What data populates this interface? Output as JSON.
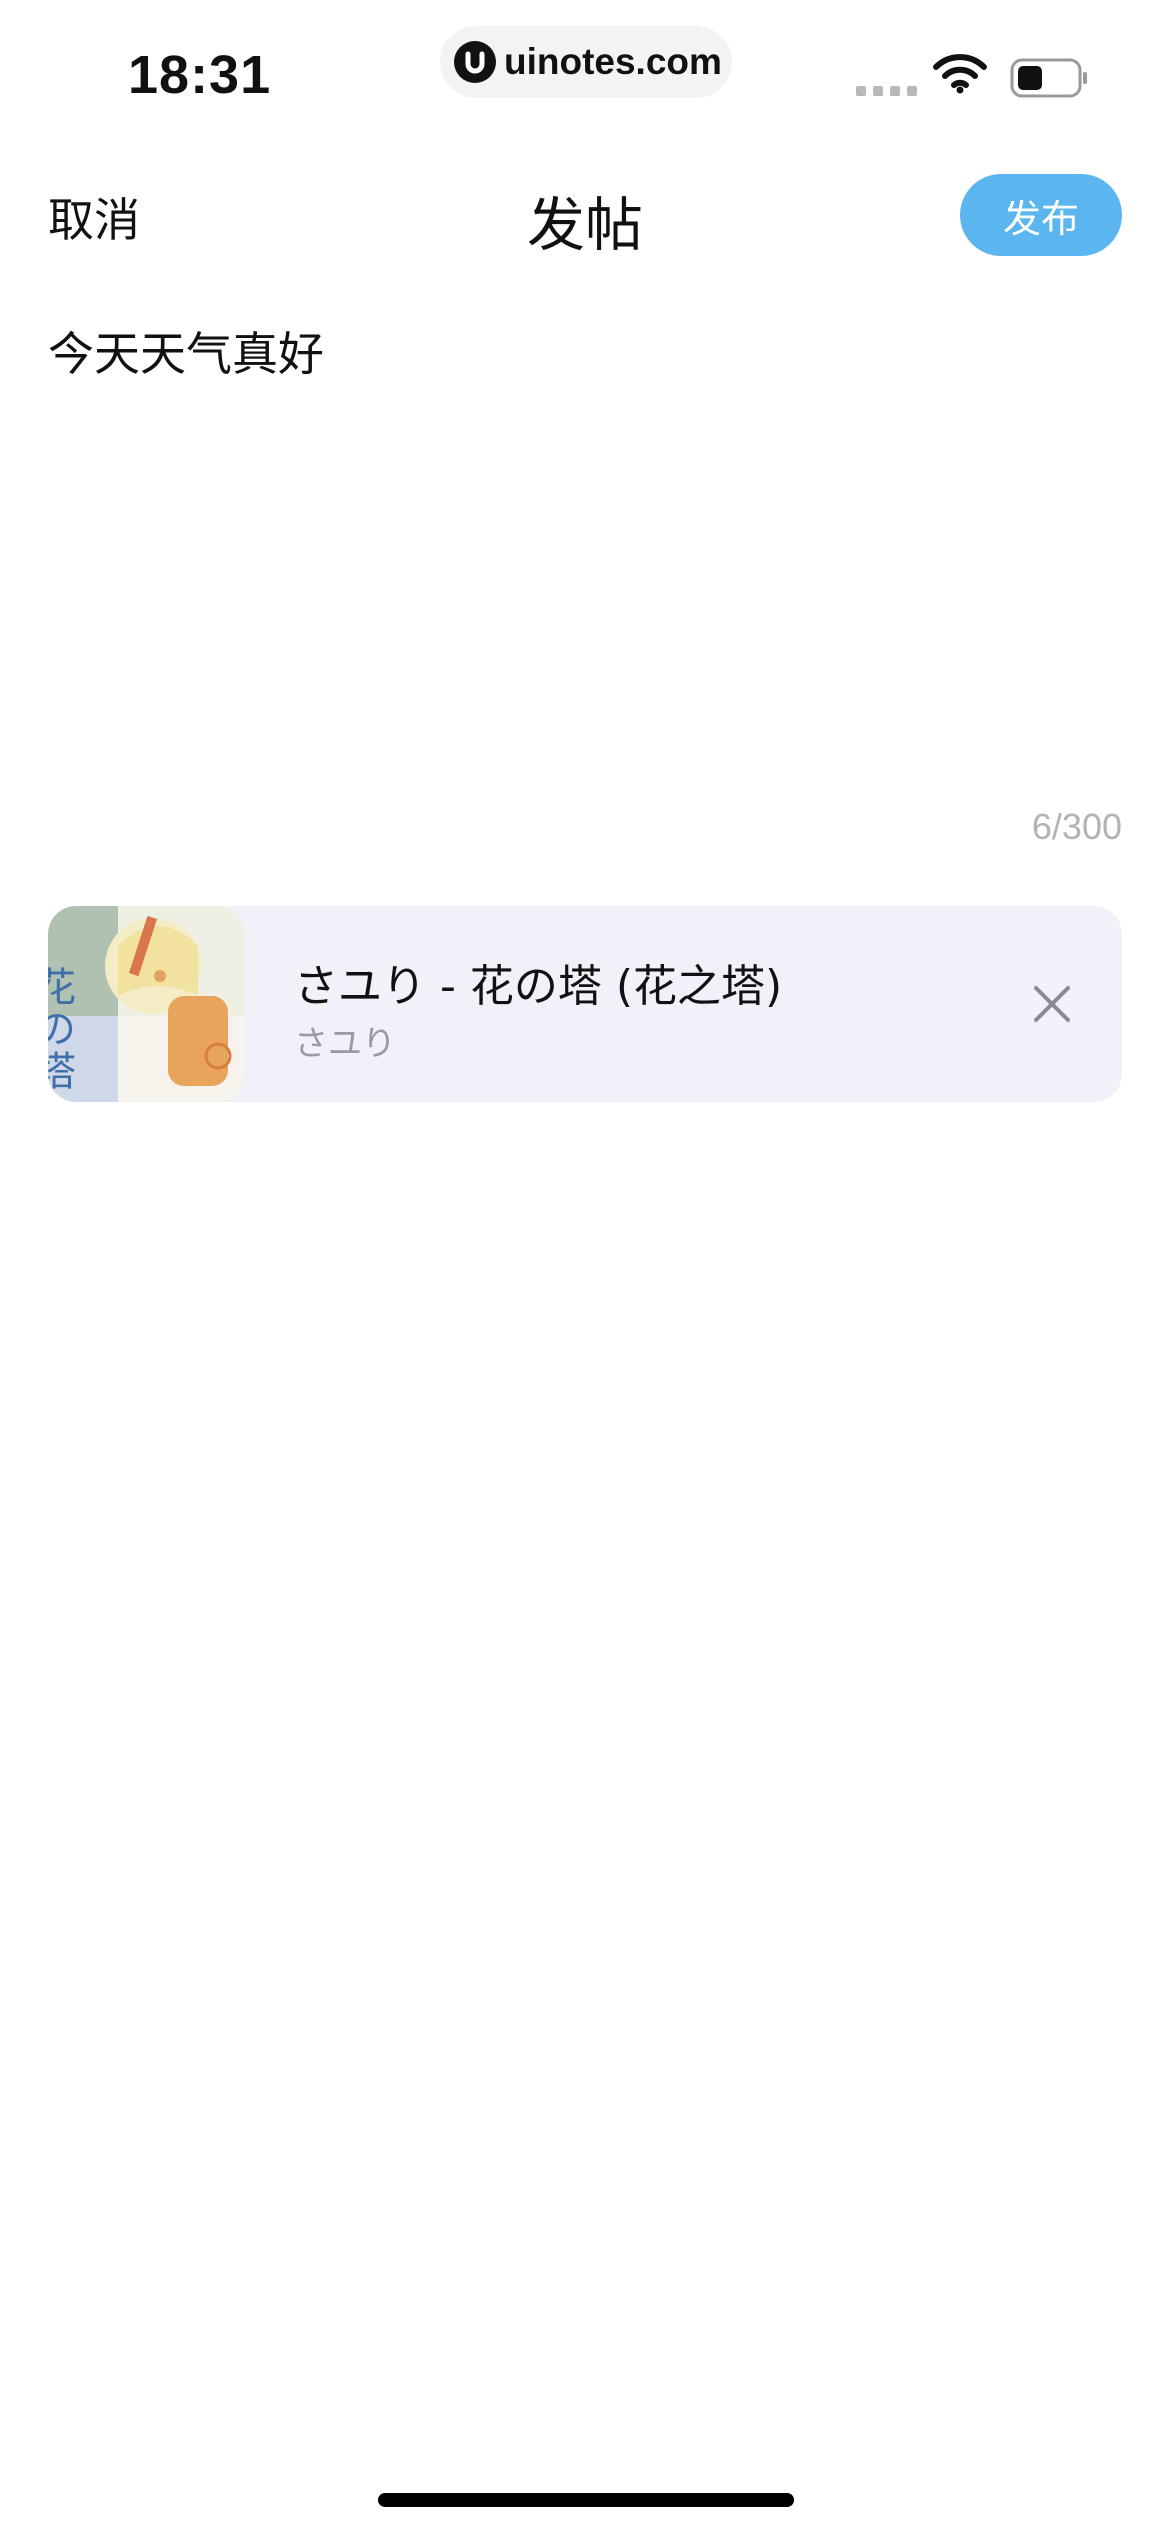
{
  "status_bar": {
    "time": "18:31",
    "url": "uinotes.com"
  },
  "nav": {
    "cancel_label": "取消",
    "title": "发帖",
    "publish_label": "发布"
  },
  "editor": {
    "text": "今天天气真好",
    "char_count": "6/300"
  },
  "music": {
    "title": "さユり - 花の塔 (花之塔)",
    "artist": "さユり",
    "album_art_text": "花の塔"
  },
  "colors": {
    "accent": "#5bb6f0",
    "card_bg": "#f0f1f9",
    "muted_text": "#9a9aa2"
  }
}
